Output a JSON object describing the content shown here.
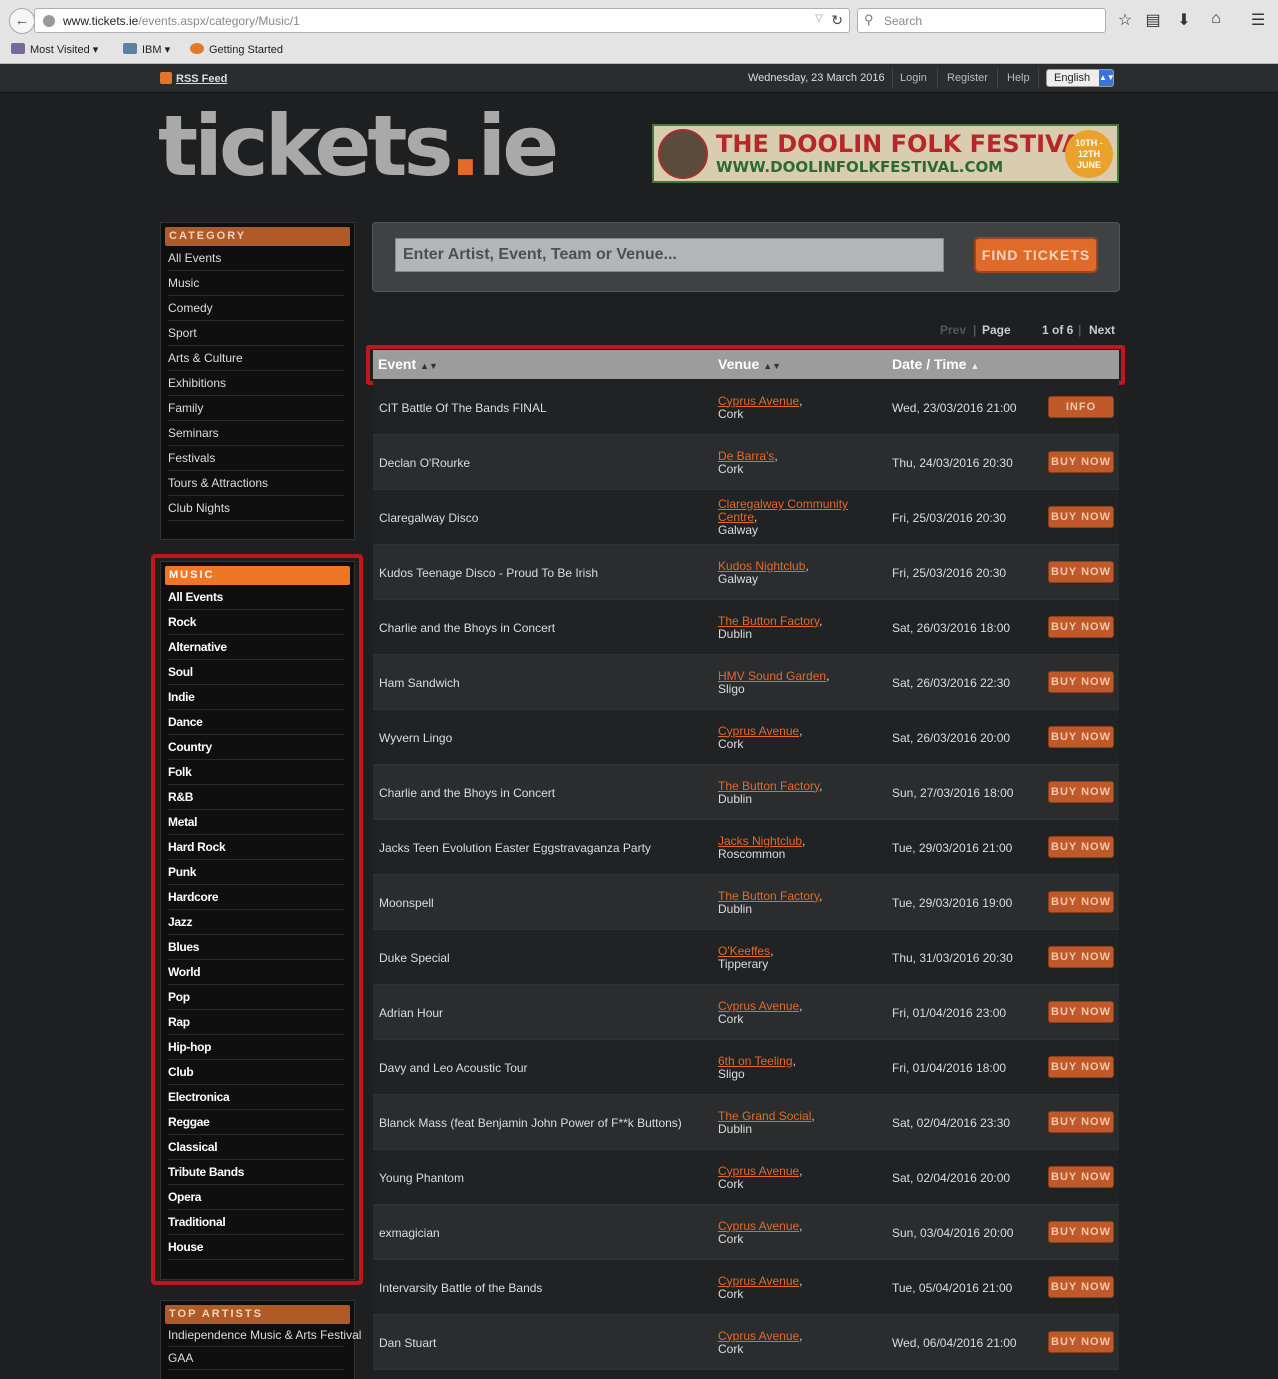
{
  "browser": {
    "url_path": "/events.aspx/category/Music/1",
    "url_domain": "www.tickets.ie",
    "search_placeholder": "Search",
    "bookmarks": [
      "Most Visited",
      "IBM",
      "Getting Started"
    ]
  },
  "topbar": {
    "rss": "RSS Feed",
    "date": "Wednesday, 23 March 2016",
    "login": "Login",
    "register": "Register",
    "help": "Help",
    "language": "English"
  },
  "logo": {
    "text_main": "tickets",
    "text_dot": ".",
    "text_tld": "ie"
  },
  "banner": {
    "title": "THE DOOLIN FOLK FESTIVAL",
    "url": "WWW.DOOLINFOLKFESTIVAL.COM",
    "dates": "10TH - 12TH JUNE"
  },
  "category": {
    "heading": "CATEGORY",
    "items": [
      "All Events",
      "Music",
      "Comedy",
      "Sport",
      "Arts & Culture",
      "Exhibitions",
      "Family",
      "Seminars",
      "Festivals",
      "Tours & Attractions",
      "Club Nights"
    ]
  },
  "music": {
    "heading": "MUSIC",
    "items": [
      "All Events",
      "Rock",
      "Alternative",
      "Soul",
      "Indie",
      "Dance",
      "Country",
      "Folk",
      "R&B",
      "Metal",
      "Hard Rock",
      "Punk",
      "Hardcore",
      "Jazz",
      "Blues",
      "World",
      "Pop",
      "Rap",
      "Hip-hop",
      "Club",
      "Electronica",
      "Reggae",
      "Classical",
      "Tribute Bands",
      "Opera",
      "Traditional",
      "House"
    ]
  },
  "top_artists": {
    "heading": "TOP ARTISTS",
    "items": [
      "Indiependence Music & Arts Festival",
      "GAA"
    ]
  },
  "search": {
    "placeholder": "Enter Artist, Event, Team or Venue...",
    "button": "FIND TICKETS"
  },
  "pagination": {
    "prev": "Prev",
    "sep": "|",
    "page": "Page",
    "count": "1 of 6",
    "next": "Next"
  },
  "table": {
    "headers": {
      "event": "Event",
      "venue": "Venue",
      "date": "Date / Time"
    },
    "rows": [
      {
        "event": "CIT Battle Of The Bands FINAL",
        "venue": "Cyprus Avenue",
        "city": "Cork",
        "date": "Wed, 23/03/2016 21:00",
        "action": "INFO"
      },
      {
        "event": "Declan O'Rourke",
        "venue": "De Barra's",
        "city": "Cork",
        "date": "Thu, 24/03/2016 20:30",
        "action": "BUY NOW"
      },
      {
        "event": "Claregalway Disco",
        "venue": "Claregalway Community Centre",
        "city": "Galway",
        "date": "Fri, 25/03/2016 20:30",
        "action": "BUY NOW"
      },
      {
        "event": "Kudos Teenage Disco - Proud To Be Irish",
        "venue": "Kudos Nightclub",
        "city": "Galway",
        "date": "Fri, 25/03/2016 20:30",
        "action": "BUY NOW"
      },
      {
        "event": "Charlie and the Bhoys in Concert",
        "venue": "The Button Factory",
        "city": "Dublin",
        "date": "Sat, 26/03/2016 18:00",
        "action": "BUY NOW"
      },
      {
        "event": "Ham Sandwich",
        "venue": "HMV Sound Garden",
        "city": "Sligo",
        "date": "Sat, 26/03/2016 22:30",
        "action": "BUY NOW"
      },
      {
        "event": "Wyvern Lingo",
        "venue": "Cyprus Avenue",
        "city": "Cork",
        "date": "Sat, 26/03/2016 20:00",
        "action": "BUY NOW"
      },
      {
        "event": "Charlie and the Bhoys in Concert",
        "venue": "The Button Factory",
        "city": "Dublin",
        "date": "Sun, 27/03/2016 18:00",
        "action": "BUY NOW"
      },
      {
        "event": "Jacks Teen Evolution Easter Eggstravaganza Party",
        "venue": "Jacks Nightclub",
        "city": "Roscommon",
        "date": "Tue, 29/03/2016 21:00",
        "action": "BUY NOW"
      },
      {
        "event": "Moonspell",
        "venue": "The Button Factory",
        "city": "Dublin",
        "date": "Tue, 29/03/2016 19:00",
        "action": "BUY NOW"
      },
      {
        "event": "Duke Special",
        "venue": "O'Keeffes",
        "city": "Tipperary",
        "date": "Thu, 31/03/2016 20:30",
        "action": "BUY NOW"
      },
      {
        "event": "Adrian Hour",
        "venue": "Cyprus Avenue",
        "city": "Cork",
        "date": "Fri, 01/04/2016 23:00",
        "action": "BUY NOW"
      },
      {
        "event": "Davy and Leo Acoustic Tour",
        "venue": "6th on Teeling",
        "city": "Sligo",
        "date": "Fri, 01/04/2016 18:00",
        "action": "BUY NOW"
      },
      {
        "event": "Blanck Mass (feat Benjamin John Power of F**k Buttons)",
        "venue": "The Grand Social",
        "city": "Dublin",
        "date": "Sat, 02/04/2016 23:30",
        "action": "BUY NOW"
      },
      {
        "event": "Young Phantom",
        "venue": "Cyprus Avenue",
        "city": "Cork",
        "date": "Sat, 02/04/2016 20:00",
        "action": "BUY NOW"
      },
      {
        "event": "exmagician",
        "venue": "Cyprus Avenue",
        "city": "Cork",
        "date": "Sun, 03/04/2016 20:00",
        "action": "BUY NOW"
      },
      {
        "event": "Intervarsity Battle of the Bands",
        "venue": "Cyprus Avenue",
        "city": "Cork",
        "date": "Tue, 05/04/2016 21:00",
        "action": "BUY NOW"
      },
      {
        "event": "Dan Stuart",
        "venue": "Cyprus Avenue",
        "city": "Cork",
        "date": "Wed, 06/04/2016 21:00",
        "action": "BUY NOW"
      }
    ]
  },
  "colors": {
    "accent": "#e36a28",
    "highlight": "#c0161c",
    "background": "#1e1f20"
  }
}
